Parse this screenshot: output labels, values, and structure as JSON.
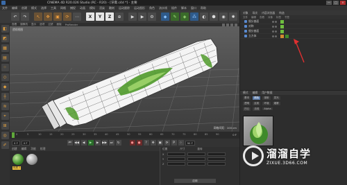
{
  "window": {
    "title": "CINEMA 4D R20.026 Studio (RC - R20) - [牙膏.c4d *] - 主要",
    "controls": [
      "—",
      "□",
      "×"
    ]
  },
  "menubar": {
    "items": [
      "文件",
      "编辑",
      "创建",
      "模式",
      "选择",
      "工具",
      "网格",
      "捕捉",
      "动画",
      "模拟",
      "渲染",
      "雕刻",
      "运动跟踪",
      "运动图形",
      "角色",
      "流水线",
      "插件",
      "脚本",
      "窗口",
      "帮助"
    ]
  },
  "toolbar": {
    "axis_x": "X",
    "axis_y": "Y",
    "axis_z": "Z"
  },
  "viewport": {
    "menu": [
      "查看",
      "摄像机",
      "显示",
      "选项",
      "过滤",
      "面板",
      "ProRender"
    ],
    "label": "透视视图",
    "grid_distance": "网格间距：100 cm"
  },
  "timeline": {
    "ticks": [
      "0",
      "5",
      "10",
      "15",
      "20",
      "25",
      "30",
      "35",
      "40",
      "45",
      "50",
      "55",
      "60",
      "65",
      "70",
      "75",
      "80",
      "85",
      "90"
    ],
    "current_frame": "0 F",
    "start_field": "0 F",
    "end_field": "90 F"
  },
  "materials": {
    "menu": [
      "创建",
      "编辑",
      "功能",
      "纹理"
    ],
    "items": [
      {
        "name": "材质.1",
        "color": "#3f8a2a"
      },
      {
        "name": "",
        "color": "#9a9a9a"
      }
    ]
  },
  "coordinates": {
    "headers": [
      "位置",
      "尺寸",
      "旋转"
    ],
    "rows": [
      "X",
      "Y",
      "Z"
    ],
    "apply_label": "应用"
  },
  "object_manager": {
    "tabs": [
      "对象",
      "场次",
      "内容浏览器",
      "构造"
    ],
    "menu": [
      "文件",
      "编辑",
      "查看",
      "对象",
      "标签",
      "书签"
    ],
    "objects": [
      {
        "name": "细分曲面",
        "icon_color": "#5a8ad0"
      },
      {
        "name": "对称",
        "icon_color": "#5a8ad0"
      },
      {
        "name": "细分曲面",
        "icon_color": "#5a8ad0"
      },
      {
        "name": "立方体",
        "icon_color": "#5a8ad0"
      }
    ]
  },
  "attributes": {
    "tabs": [
      "模式",
      "编辑",
      "用户数据"
    ],
    "sub_tabs": [
      "基本",
      "颜色",
      "漫射",
      "发光",
      "透明",
      "反射",
      "环境",
      "烟雾",
      "凹凸",
      "法线",
      "Alpha"
    ]
  },
  "watermark": {
    "main": "溜溜自学",
    "sub": "ZIXUE.3D66.COM"
  },
  "colors": {
    "accent_green": "#5fa83a",
    "arrow_red": "#e03030",
    "selected_tab": "#5a7aa8"
  }
}
